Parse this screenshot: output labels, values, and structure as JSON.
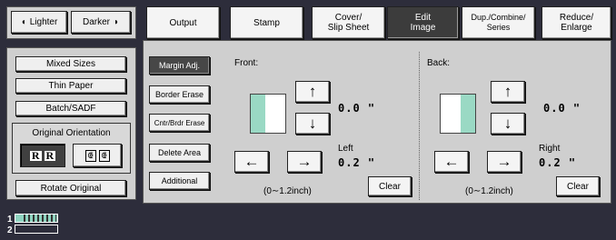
{
  "density": {
    "lighter": "Lighter",
    "darker": "Darker"
  },
  "original_settings": {
    "mixed_sizes": "Mixed Sizes",
    "thin_paper": "Thin Paper",
    "batch_sadf": "Batch/SADF",
    "orientation_title": "Original Orientation",
    "rotate_original": "Rotate Original"
  },
  "tabs": {
    "output": "Output",
    "stamp": "Stamp",
    "cover": "Cover/\nSlip Sheet",
    "edit": "Edit\nImage",
    "dup": "Dup./Combine/\nSeries",
    "reduce": "Reduce/\nEnlarge"
  },
  "edit_menu": {
    "margin_adj": "Margin Adj.",
    "border_erase": "Border Erase",
    "cntr_brdr_erase": "Cntr/Brdr Erase",
    "delete_area": "Delete Area",
    "additional": "Additional"
  },
  "front": {
    "label": "Front:",
    "vertical_value": "0.0 \"",
    "side_label": "Left",
    "horizontal_value": "0.2 \"",
    "range": "(0∼1.2inch)",
    "clear": "Clear"
  },
  "back": {
    "label": "Back:",
    "vertical_value": "0.0 \"",
    "side_label": "Right",
    "horizontal_value": "0.2 \"",
    "range": "(0∼1.2inch)",
    "clear": "Clear"
  },
  "status": {
    "line1": "1",
    "line2": "2"
  },
  "colors": {
    "background": "#2d2d3b",
    "panel": "#cfcfcf",
    "margin_preview": "#9ad9c4",
    "active_tab": "#3c3c3c"
  }
}
